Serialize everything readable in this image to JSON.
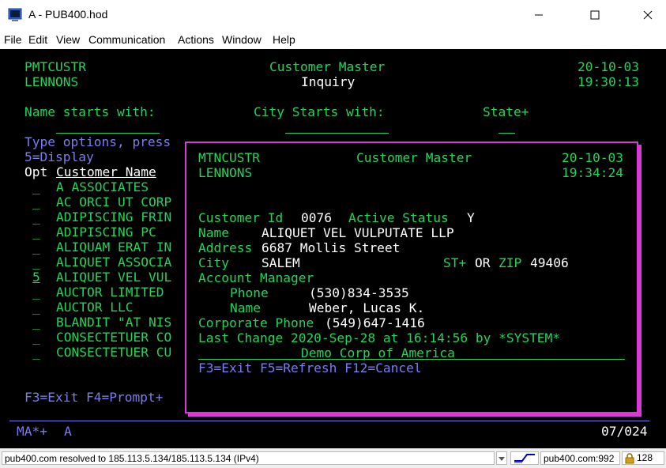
{
  "window": {
    "title": "A - PUB400.hod",
    "icons": [
      "terminal-app-icon",
      "minimize-icon",
      "maximize-icon",
      "close-icon"
    ]
  },
  "menu": [
    "File",
    "Edit",
    "View",
    "Communication",
    "Actions",
    "Window",
    "Help"
  ],
  "screen": {
    "program": "PMTCUSTR",
    "user": "LENNONS",
    "title": "Customer Master",
    "subtitle": "Inquiry",
    "date": "20-10-03",
    "time": "19:30:13",
    "name_filter_label": "Name starts with:",
    "city_filter_label": "City Starts with:",
    "state_filter_label": "State+",
    "options_line1": "Type options, press",
    "options_line2": "5=Display",
    "opt_header": "Opt",
    "name_header": "Customer Name",
    "rows": [
      {
        "opt": "_",
        "name": "A ASSOCIATES"
      },
      {
        "opt": "_",
        "name": "AC ORCI UT CORP"
      },
      {
        "opt": "_",
        "name": "ADIPISCING FRIN"
      },
      {
        "opt": "_",
        "name": "ADIPISCING PC"
      },
      {
        "opt": "_",
        "name": "ALIQUAM ERAT IN"
      },
      {
        "opt": "_",
        "name": "ALIQUET ASSOCIA"
      },
      {
        "opt": "5",
        "name": "ALIQUET VEL VUL"
      },
      {
        "opt": "_",
        "name": "AUCTOR LIMITED"
      },
      {
        "opt": "_",
        "name": "AUCTOR LLC"
      },
      {
        "opt": "_",
        "name": "BLANDIT \"AT NIS"
      },
      {
        "opt": "_",
        "name": "CONSECTETUER CO"
      },
      {
        "opt": "_",
        "name": "CONSECTETUER CU"
      }
    ],
    "fkeys": "F3=Exit F4=Prompt+"
  },
  "popup": {
    "program": "MTNCUSTR",
    "user": "LENNONS",
    "title": "Customer Master",
    "date": "20-10-03",
    "time": "19:34:24",
    "customer_id_label": "Customer Id",
    "customer_id": "0076",
    "active_status_label": "Active Status",
    "active_status": "Y",
    "name_label": "Name",
    "name": "ALIQUET VEL VULPUTATE LLP",
    "address_label": "Address",
    "address": "6687 Mollis Street",
    "city_label": "City",
    "city": "SALEM",
    "st_label": "ST+",
    "or_label": "OR",
    "zip_label": "ZIP",
    "zip": "49406",
    "account_manager_label": "Account Manager",
    "phone_label": "Phone",
    "phone": "(530)834-3535",
    "am_name_label": "Name",
    "am_name": "Weber, Lucas K.",
    "corp_phone_label": "Corporate Phone",
    "corp_phone": "(549)647-1416",
    "last_change": "Last Change 2020-Sep-28 at 16:14:56 by *SYSTEM*",
    "company": "Demo Corp of America",
    "fkeys": "F3=Exit F5=Refresh F12=Cancel"
  },
  "oia": {
    "left": "MA*+",
    "session": "A",
    "cursor": "07/024"
  },
  "statusbar": {
    "message": "pub400.com resolved to 185.113.5.134/185.113.5.134 (IPv4)",
    "host": "pub400.com:992",
    "cipher": "128",
    "icons": [
      "connection-icon",
      "lock-icon"
    ]
  },
  "colors": {
    "terminal_bg": "#000000",
    "green": "#1fd65a",
    "white": "#ffffff",
    "blue": "#7b7bf2",
    "popup_border": "#d63bd6"
  }
}
